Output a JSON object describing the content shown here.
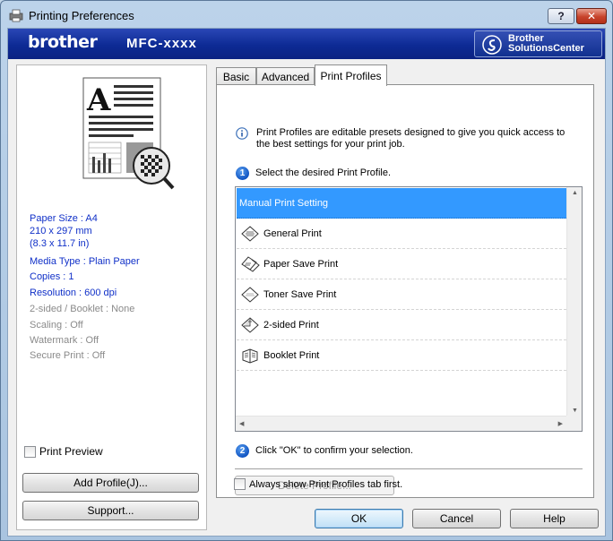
{
  "window": {
    "title": "Printing Preferences",
    "help_glyph": "?",
    "close_glyph": "✕"
  },
  "banner": {
    "brand": "brother",
    "model": "MFC-xxxx",
    "solutions_label": "Brother\nSolutionsCenter"
  },
  "summary": {
    "paper_size": "Paper Size : A4",
    "paper_dims": "210 x 297 mm",
    "paper_dims_in": "(8.3 x 11.7 in)",
    "media_type": "Media Type : Plain Paper",
    "copies": "Copies : 1",
    "resolution": "Resolution : 600 dpi",
    "two_sided": "2-sided / Booklet : None",
    "scaling": "Scaling : Off",
    "watermark": "Watermark : Off",
    "secure_print": "Secure Print : Off"
  },
  "left_controls": {
    "print_preview": "Print Preview",
    "add_profile": "Add Profile(J)...",
    "support": "Support..."
  },
  "tabs": [
    {
      "label": "Basic"
    },
    {
      "label": "Advanced"
    },
    {
      "label": "Print Profiles"
    }
  ],
  "profiles_tab": {
    "description": "Print Profiles are editable presets designed to give you quick access to the best settings for your print job.",
    "step1_num": "1",
    "step1": "Select the desired Print Profile.",
    "items": [
      {
        "label": "Manual Print Setting",
        "icon": "none"
      },
      {
        "label": "General Print",
        "icon": "general-print-icon"
      },
      {
        "label": "Paper Save Print",
        "icon": "paper-save-icon"
      },
      {
        "label": "Toner Save Print",
        "icon": "toner-save-icon"
      },
      {
        "label": "2-sided Print",
        "icon": "two-sided-icon"
      },
      {
        "label": "Booklet Print",
        "icon": "booklet-icon"
      }
    ],
    "step2_num": "2",
    "step2": "Click \"OK\" to confirm your selection.",
    "delete_profile": "Delete Profile...",
    "always_show": "Always show Print Profiles tab first."
  },
  "buttons": {
    "ok": "OK",
    "cancel": "Cancel",
    "help": "Help"
  },
  "colors": {
    "banner": "#0d2a94",
    "selection": "#3399ff",
    "summary_text": "#1030c8"
  }
}
